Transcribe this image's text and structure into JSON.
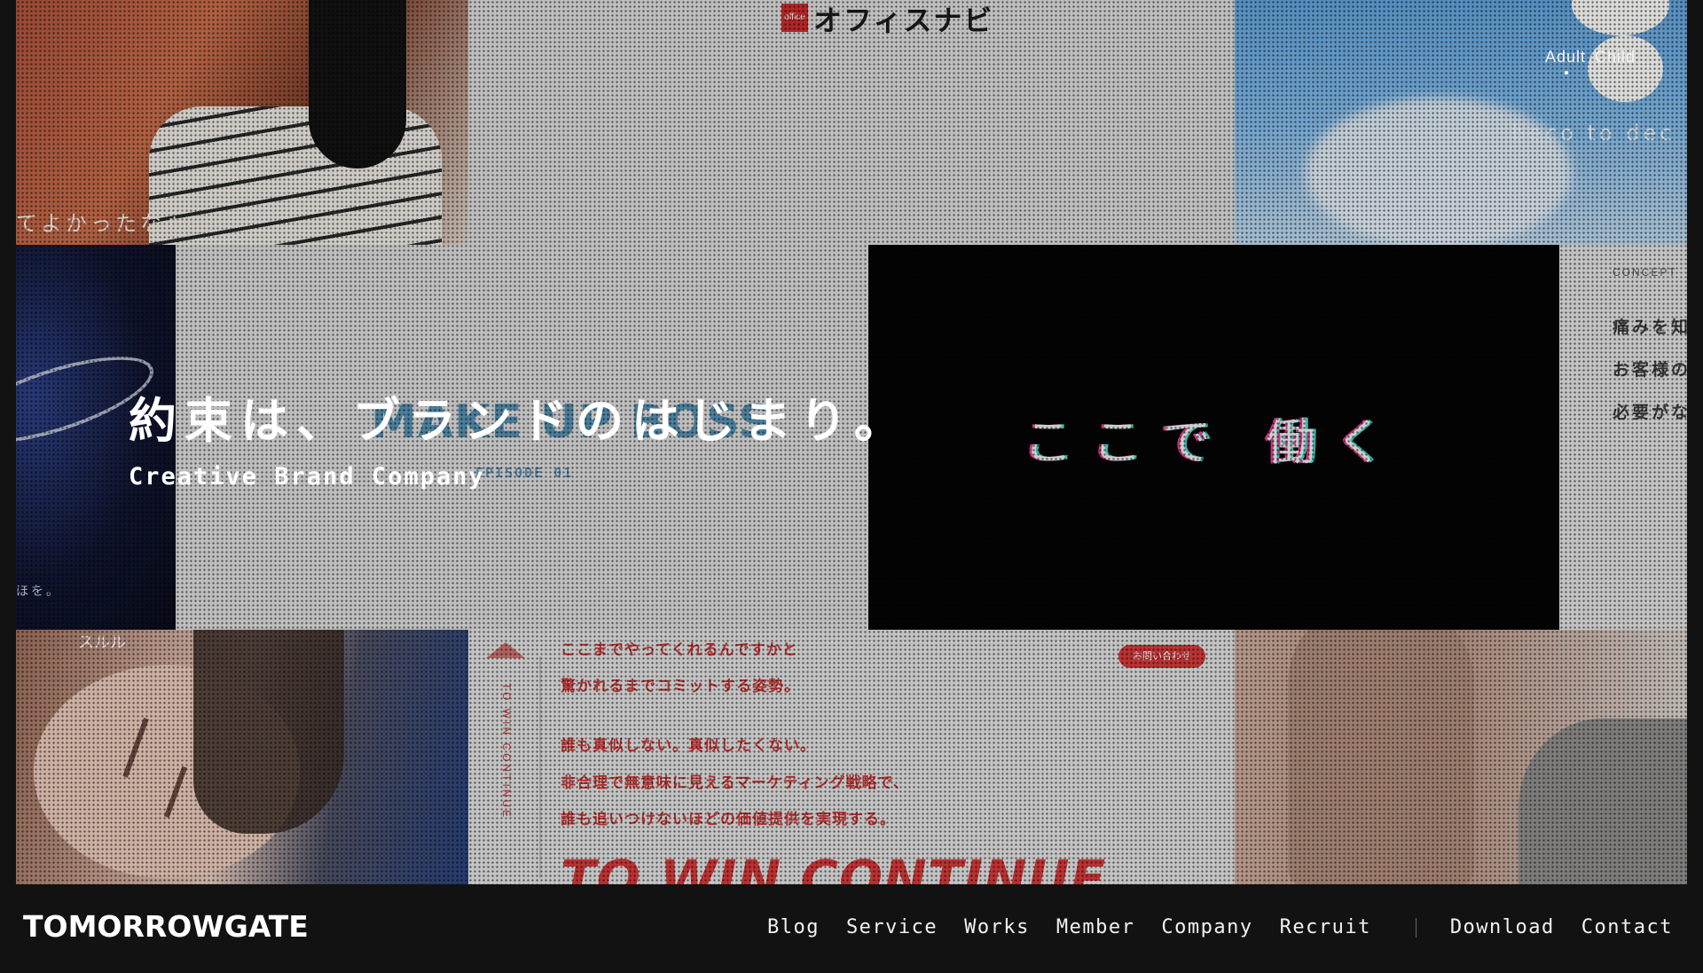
{
  "hero": {
    "headline": "約束は、ブランドのはじまり。",
    "subhead": "Creative Brand Company",
    "toggle": {
      "adult": "Adult",
      "child": "Child"
    },
    "tiles": {
      "girl_caption": "てよかったなぁ",
      "logo_mark": "office",
      "logo_brand": "オフィスナビ",
      "sky_text": "beco to dec",
      "space_caption": "ほを。",
      "makeup_text": "MAKE UP BOSS",
      "episode_text": "EPISODE 01",
      "video_text": "ここで 働く",
      "concept_label": "CONCEPT",
      "concept_lines": [
        "痛みを知",
        "お客様の",
        "必要がな"
      ],
      "baby_mark": "スルル",
      "copy_vertical": "TO WIN CONTINUE",
      "copy_pill": "お問い合わせ",
      "copy_lines": [
        "ここまでやってくれるんですかと",
        "驚かれるまでコミットする姿勢。",
        "",
        "誰も真似しない。真似したくない。",
        "非合理で無意味に見えるマーケティング戦略で、",
        "誰も追いつけないほどの価値提供を実現する。"
      ],
      "copy_big": "TO WIN CONTINUE"
    }
  },
  "footer": {
    "logo": "TOMORROWGATE",
    "nav": [
      "Blog",
      "Service",
      "Works",
      "Member",
      "Company",
      "Recruit"
    ],
    "actions": [
      "Download",
      "Contact"
    ]
  }
}
